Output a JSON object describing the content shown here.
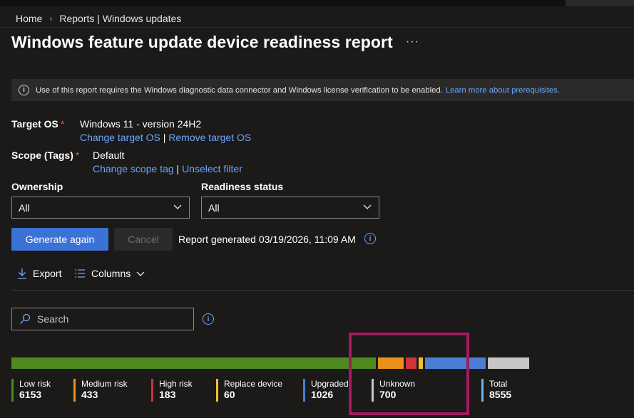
{
  "breadcrumb": {
    "home": "Home",
    "section": "Reports | Windows updates"
  },
  "page": {
    "title": "Windows feature update device readiness report",
    "more": "···"
  },
  "infobar": {
    "icon": "info-icon",
    "text": "Use of this report requires the Windows diagnostic data connector and Windows license verification to be enabled.",
    "link": "Learn more about prerequisites."
  },
  "target_os": {
    "label": "Target OS",
    "required": "*",
    "value": "Windows 11 - version 24H2",
    "link1": "Change target OS",
    "sep": " | ",
    "link2": "Remove target OS"
  },
  "scope": {
    "label": "Scope (Tags)",
    "required": "*",
    "value": "Default",
    "link1": "Change scope tag",
    "sep": " | ",
    "link2": "Unselect filter"
  },
  "filters": {
    "ownership": {
      "label": "Ownership",
      "value": "All"
    },
    "readiness": {
      "label": "Readiness status",
      "value": "All"
    }
  },
  "actions": {
    "generate": "Generate again",
    "cancel": "Cancel",
    "generated_text": "Report generated 03/19/2026, 11:09 AM"
  },
  "toolbar": {
    "export": "Export",
    "columns": "Columns"
  },
  "search": {
    "placeholder": "Search"
  },
  "summary": {
    "categories": [
      {
        "label": "Low risk",
        "value": 6153,
        "color": "#4e8a1e"
      },
      {
        "label": "Medium risk",
        "value": 433,
        "color": "#e8921d"
      },
      {
        "label": "High risk",
        "value": 183,
        "color": "#d13438"
      },
      {
        "label": "Replace device",
        "value": 60,
        "color": "#f2c02e"
      },
      {
        "label": "Upgraded",
        "value": 1026,
        "color": "#4a7fd4"
      },
      {
        "label": "Unknown",
        "value": 700,
        "color": "#c8c6c4"
      }
    ],
    "total": {
      "label": "Total",
      "value": 8555,
      "color": "#6ab4f0"
    }
  }
}
